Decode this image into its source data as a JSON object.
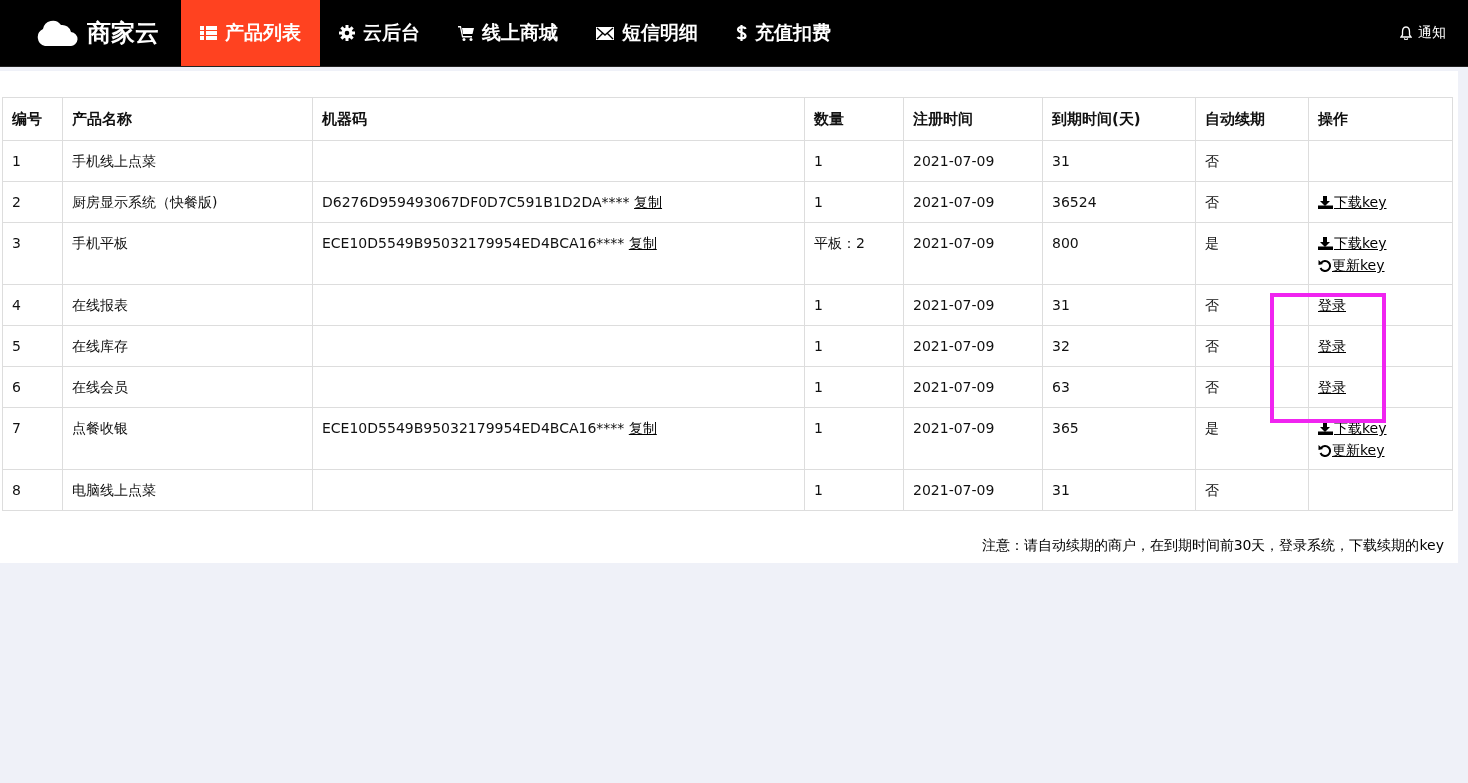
{
  "brand": "商家云",
  "nav": [
    {
      "label": "产品列表",
      "kind": "list",
      "selected": true
    },
    {
      "label": "云后台",
      "kind": "backend",
      "selected": false
    },
    {
      "label": "线上商城",
      "kind": "shop",
      "selected": false
    },
    {
      "label": "短信明细",
      "kind": "sms",
      "selected": false
    },
    {
      "label": "充值扣费",
      "kind": "billing",
      "selected": false
    }
  ],
  "notification": "通知",
  "table": {
    "columns": [
      "编号",
      "产品名称",
      "机器码",
      "数量",
      "注册时间",
      "到期时间(天)",
      "自动续期",
      "操作"
    ],
    "rows": [
      {
        "id": "1",
        "name": "手机线上点菜",
        "code": null,
        "qty": "1",
        "registered": "2021-07-09",
        "expires": "31",
        "auto_renew": "否",
        "actions": []
      },
      {
        "id": "2",
        "name": "厨房显示系统（快餐版)",
        "code": {
          "text": "D6276D959493067DF0D7C591B1D2DA****",
          "copy": "复制"
        },
        "qty": "1",
        "registered": "2021-07-09",
        "expires": "36524",
        "auto_renew": "否",
        "actions": [
          {
            "kind": "download",
            "label": "下载key"
          }
        ]
      },
      {
        "id": "3",
        "name": "手机平板",
        "code": {
          "text": "ECE10D5549B95032179954ED4BCA16****",
          "copy": "复制"
        },
        "qty": "平板：2",
        "registered": "2021-07-09",
        "expires": "800",
        "auto_renew": "是",
        "actions": [
          {
            "kind": "download",
            "label": "下载key"
          },
          {
            "kind": "refresh",
            "label": "更新key"
          }
        ]
      },
      {
        "id": "4",
        "name": "在线报表",
        "code": null,
        "qty": "1",
        "registered": "2021-07-09",
        "expires": "31",
        "auto_renew": "否",
        "actions": [
          {
            "kind": "login",
            "label": "登录"
          }
        ]
      },
      {
        "id": "5",
        "name": "在线库存",
        "code": null,
        "qty": "1",
        "registered": "2021-07-09",
        "expires": "32",
        "auto_renew": "否",
        "actions": [
          {
            "kind": "login",
            "label": "登录"
          }
        ]
      },
      {
        "id": "6",
        "name": "在线会员",
        "code": null,
        "qty": "1",
        "registered": "2021-07-09",
        "expires": "63",
        "auto_renew": "否",
        "actions": [
          {
            "kind": "login",
            "label": "登录"
          }
        ]
      },
      {
        "id": "7",
        "name": "点餐收银",
        "code": {
          "text": "ECE10D5549B95032179954ED4BCA16****",
          "copy": "复制"
        },
        "qty": "1",
        "registered": "2021-07-09",
        "expires": "365",
        "auto_renew": "是",
        "actions": [
          {
            "kind": "download",
            "label": "下载key"
          },
          {
            "kind": "refresh",
            "label": "更新key"
          }
        ]
      },
      {
        "id": "8",
        "name": "电脑线上点菜",
        "code": null,
        "qty": "1",
        "registered": "2021-07-09",
        "expires": "31",
        "auto_renew": "否",
        "actions": []
      }
    ]
  },
  "note": "注意：请自动续期的商户，在到期时间前30天，登录系统，下载续期的key"
}
